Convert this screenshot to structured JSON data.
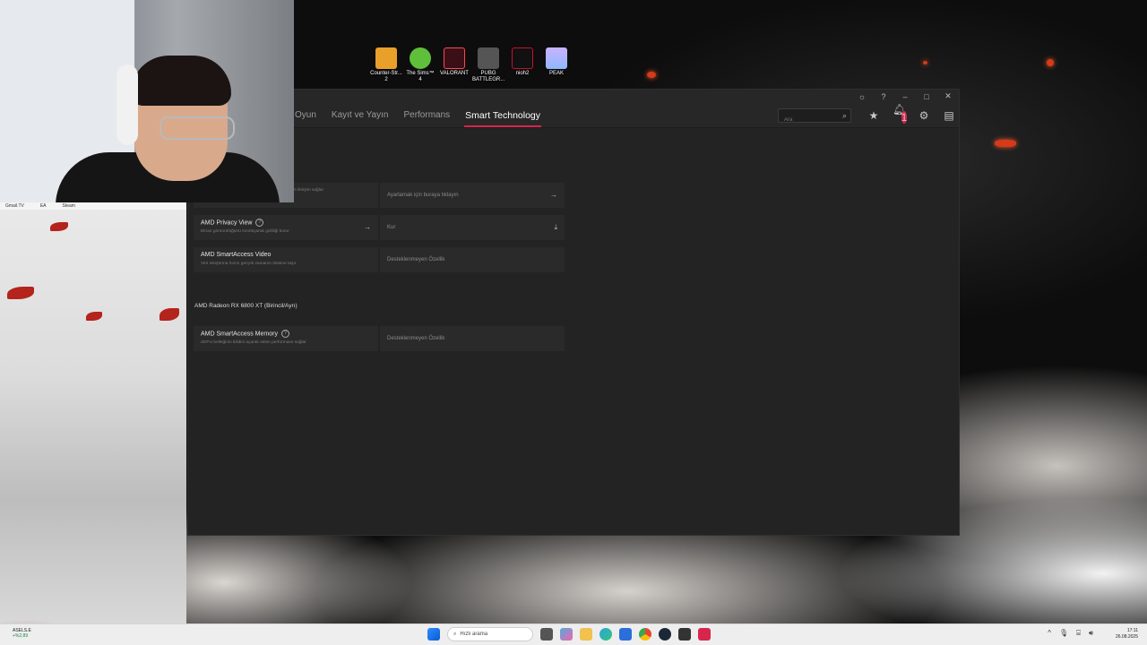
{
  "desktop": {
    "icons": [
      {
        "label": "Counter-Str... 2",
        "icon": "counter-strike-icon",
        "color": "#e8a02a"
      },
      {
        "label": "The Sims™ 4",
        "icon": "sims-icon",
        "color": "#5fbf3a"
      },
      {
        "label": "VALORANT",
        "icon": "valorant-icon",
        "color": "#ff4655"
      },
      {
        "label": "PUBG BATTLEGR...",
        "icon": "pubg-icon",
        "color": "#f2b43a"
      },
      {
        "label": "nioh2",
        "icon": "nioh2-icon",
        "color": "#c8102e"
      },
      {
        "label": "PEAK",
        "icon": "peak-icon",
        "color": "#8fb8ff"
      }
    ]
  },
  "browser": {
    "bookmarks": [
      "Gmail.TV",
      "EA",
      "Steam"
    ]
  },
  "app": {
    "nav": {
      "tabs": [
        "Oyun",
        "Kayıt ve Yayın",
        "Performans",
        "Smart Technology"
      ],
      "active_tab": "Smart Technology",
      "search_placeholder": "Ara",
      "notification_count": "1"
    },
    "features": [
      {
        "name": "",
        "desc": "a net iletişim sağlar",
        "action": "Ayarlamak için buraya tıklayın",
        "action_icon": "arrow-right-icon"
      },
      {
        "name": "AMD Privacy View",
        "desc": "Ekran görünürlüğünü sınırlayarak gizliliği korur",
        "action": "Kur",
        "action_icon": "download-icon"
      },
      {
        "name": "AMD SmartAccess Video",
        "desc": "Veri sıkıştırma hızını gerçek zamanın ötesine taşır",
        "action": "Desteklenmeyen Özellik",
        "action_icon": ""
      }
    ],
    "gpu_section": {
      "title": "AMD Radeon RX 6800 XT (Birincil/Ayrı)",
      "features": [
        {
          "name": "AMD SmartAccess Memory",
          "desc": "dGPU belleğinin kilidini açarak üstün performans sağlar",
          "action": "Desteklenmeyen Özellik"
        }
      ]
    },
    "colors": {
      "accent": "#d8254c",
      "bg": "#232323",
      "card": "#2a2a2a"
    }
  },
  "taskbar": {
    "stock_symbol": "ASELS.E",
    "stock_change": "+%2,89",
    "search_placeholder": "Hızlı arama",
    "time": "17:11",
    "date": "26.08.2025"
  }
}
